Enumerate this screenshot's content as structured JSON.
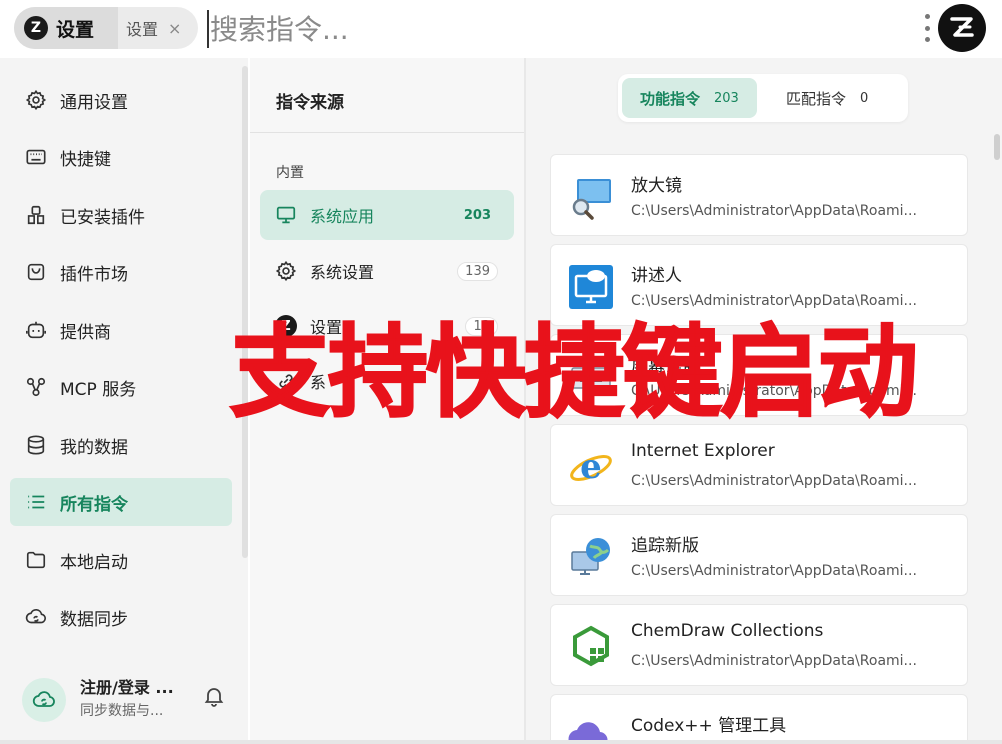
{
  "topbar": {
    "tab_main_label": "设置",
    "tab_sub_label": "设置",
    "tab_close": "×",
    "search_placeholder": "搜索指令..."
  },
  "sidebar": {
    "items": [
      {
        "label": "通用设置",
        "icon": "gear-icon"
      },
      {
        "label": "快捷键",
        "icon": "keyboard-icon"
      },
      {
        "label": "已安装插件",
        "icon": "plugin-icon"
      },
      {
        "label": "插件市场",
        "icon": "shopping-bag-icon"
      },
      {
        "label": "提供商",
        "icon": "bot-icon"
      },
      {
        "label": "MCP 服务",
        "icon": "network-icon"
      },
      {
        "label": "我的数据",
        "icon": "database-icon"
      },
      {
        "label": "所有指令",
        "icon": "list-icon",
        "active": true
      },
      {
        "label": "本地启动",
        "icon": "folder-icon"
      },
      {
        "label": "数据同步",
        "icon": "cloud-sync-icon"
      }
    ],
    "user": {
      "name": "注册/登录 ...",
      "subtitle": "同步数据与..."
    }
  },
  "sources": {
    "title": "指令来源",
    "section": "内置",
    "items": [
      {
        "label": "系统应用",
        "count": "203",
        "icon": "monitor-icon",
        "active": true
      },
      {
        "label": "系统设置",
        "count": "139",
        "icon": "gear-icon"
      },
      {
        "label": "设置",
        "count": "13",
        "icon": "ztools-logo-icon"
      },
      {
        "label": "系",
        "count": "",
        "icon": "link-icon"
      }
    ]
  },
  "tabs": {
    "functional": {
      "label": "功能指令",
      "count": "203"
    },
    "matching": {
      "label": "匹配指令",
      "count": "0"
    }
  },
  "commands": [
    {
      "name": "放大镜",
      "path": "C:\\Users\\Administrator\\AppData\\Roami...",
      "icon": "magnifier-icon"
    },
    {
      "name": "讲述人",
      "path": "C:\\Users\\Administrator\\AppData\\Roami...",
      "icon": "narrator-icon"
    },
    {
      "name": "屏幕键盘",
      "path": "C:\\Users\\Administrator\\AppData\\Roami...",
      "icon": "keyboard-app-icon"
    },
    {
      "name": "Internet Explorer",
      "path": "C:\\Users\\Administrator\\AppData\\Roami...",
      "icon": "internet-explorer-icon"
    },
    {
      "name": "追踪新版",
      "path": "C:\\Users\\Administrator\\AppData\\Roami...",
      "icon": "globe-monitor-icon"
    },
    {
      "name": "ChemDraw Collections",
      "path": "C:\\Users\\Administrator\\AppData\\Roami...",
      "icon": "chemdraw-icon"
    },
    {
      "name": "Codex++ 管理工具",
      "path": "",
      "icon": "cloud-app-icon"
    }
  ],
  "overlay": {
    "text": "支持快捷键启动"
  },
  "colors": {
    "accent": "#17855d",
    "accent_bg": "#d6ece4",
    "overlay_red": "#e8121b"
  }
}
